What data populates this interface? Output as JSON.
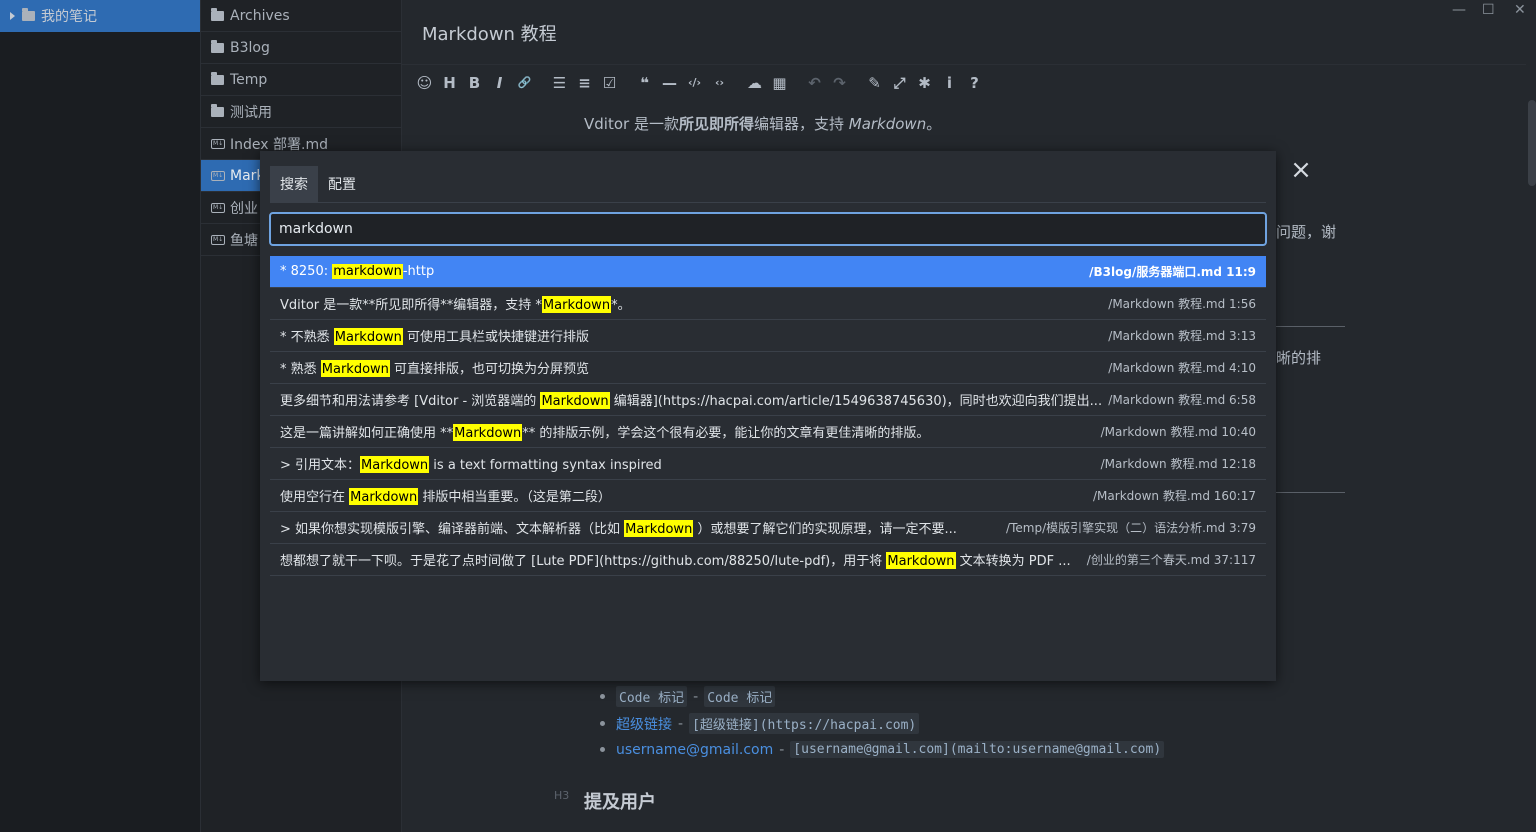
{
  "tree": {
    "root_label": "我的笔记"
  },
  "files": [
    {
      "name": "Archives",
      "type": "folder",
      "active": false
    },
    {
      "name": "B3log",
      "type": "folder",
      "active": false
    },
    {
      "name": "Temp",
      "type": "folder",
      "active": false
    },
    {
      "name": "测试用",
      "type": "folder",
      "active": false
    },
    {
      "name": "Index 部署.md",
      "type": "md",
      "active": false
    },
    {
      "name": "Mark",
      "type": "md",
      "active": true
    },
    {
      "name": "创业",
      "type": "md",
      "active": false
    },
    {
      "name": "鱼塘",
      "type": "md",
      "active": false
    }
  ],
  "editor": {
    "title": "Markdown 教程",
    "intro_pre": "Vditor 是一款",
    "intro_bold": "所见即所得",
    "intro_mid": "编辑器，支持 ",
    "intro_italic": "Markdown",
    "intro_post": "。",
    "peek_1": "问题，谢",
    "peek_2": "晰的排",
    "bullet_code_1": "Code 标记",
    "bullet_code_sep": "-",
    "bullet_code_2": "Code 标记",
    "bullet_link_text": "超级链接",
    "bullet_link_sep": "-",
    "bullet_link_code": "[超级链接](https://hacpai.com)",
    "bullet_mail_text": "username@gmail.com",
    "bullet_mail_sep": "-",
    "bullet_mail_code": "[username@gmail.com](mailto:username@gmail.com)",
    "h3_marker": "H3",
    "h3_text": "提及用户"
  },
  "toolbar_icons": [
    "emoji-icon",
    "heading-icon",
    "bold-icon",
    "italic-icon",
    "link-icon",
    "list-icon",
    "ordered-list-icon",
    "check-icon",
    "quote-icon",
    "line-icon",
    "inline-code-icon",
    "code-icon",
    "upload-icon",
    "table-icon",
    "undo-icon",
    "redo-icon",
    "edit-mode-icon",
    "fullscreen-icon",
    "debug-icon",
    "info-icon",
    "help-icon"
  ],
  "dialog": {
    "tabs": [
      "搜索",
      "配置"
    ],
    "search_value": "markdown",
    "results": [
      {
        "pre": "* 8250: ",
        "hl": "markdown",
        "post": "-http",
        "path": "/B3log/服务器端口.md 11:9",
        "active": true
      },
      {
        "pre": "Vditor 是一款**所见即所得**编辑器，支持 *",
        "hl": "Markdown",
        "post": "*。",
        "path": "/Markdown 教程.md 1:56",
        "active": false
      },
      {
        "pre": "* 不熟悉 ",
        "hl": "Markdown",
        "post": " 可使用工具栏或快捷键进行排版",
        "path": "/Markdown 教程.md 3:13",
        "active": false
      },
      {
        "pre": "* 熟悉 ",
        "hl": "Markdown",
        "post": " 可直接排版，也可切换为分屏预览",
        "path": "/Markdown 教程.md 4:10",
        "active": false
      },
      {
        "pre": "更多细节和用法请参考 [Vditor - 浏览器端的 ",
        "hl": "Markdown",
        "post": " 编辑器](https://hacpai.com/article/1549638745630)，同时也欢迎向我们提出...",
        "path": "/Markdown 教程.md 6:58",
        "active": false
      },
      {
        "pre": "这是一篇讲解如何正确使用 **",
        "hl": "Markdown",
        "post": "** 的排版示例，学会这个很有必要，能让你的文章有更佳清晰的排版。",
        "path": "/Markdown 教程.md 10:40",
        "active": false
      },
      {
        "pre": "> 引用文本：",
        "hl": "Markdown",
        "post": " is a text formatting syntax inspired",
        "path": "/Markdown 教程.md 12:18",
        "active": false
      },
      {
        "pre": "使用空行在 ",
        "hl": "Markdown",
        "post": " 排版中相当重要。（这是第二段）",
        "path": "/Markdown 教程.md 160:17",
        "active": false
      },
      {
        "pre": "> 如果你想实现模版引擎、编译器前端、文本解析器（比如 ",
        "hl": "Markdown",
        "post": " ）或想要了解它们的实现原理，请一定不要...",
        "path": "/Temp/模版引擎实现（二）语法分析.md 3:79",
        "active": false
      },
      {
        "pre": "想都想了就干一下呗。于是花了点时间做了 [Lute PDF](https://github.com/88250/lute-pdf)，用于将 ",
        "hl": "Markdown",
        "post": " 文本转换为 PDF ...",
        "path": "/创业的第三个春天.md 37:117",
        "active": false
      }
    ]
  }
}
